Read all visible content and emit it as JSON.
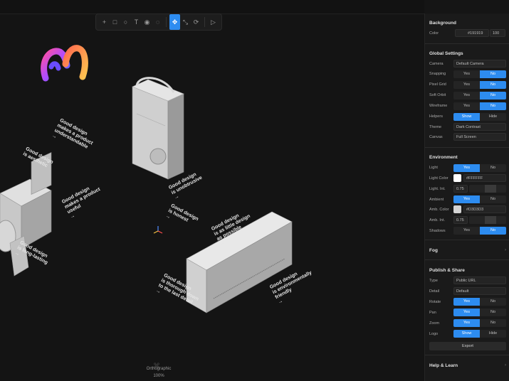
{
  "toolbar": {
    "tools": [
      {
        "name": "add-icon",
        "glyph": "+"
      },
      {
        "name": "cube-icon",
        "glyph": "□"
      },
      {
        "name": "sphere-icon",
        "glyph": "○"
      },
      {
        "name": "text-icon",
        "glyph": "T"
      },
      {
        "name": "image-icon",
        "glyph": "◉"
      },
      {
        "name": "material-icon",
        "glyph": "◌"
      },
      {
        "name": "move-icon",
        "glyph": "✥"
      },
      {
        "name": "scale-icon",
        "glyph": "⤡"
      },
      {
        "name": "rotate-icon",
        "glyph": "⟳"
      },
      {
        "name": "play-icon",
        "glyph": "▷"
      }
    ]
  },
  "viewport": {
    "camera_label": "Orthographic",
    "zoom": "100%",
    "annotations": [
      "Good design\nis aesthetic",
      "Good design\nmakes a product\nunderstandable\n→",
      "Good design\nmakes a product\nuseful\n→",
      "Good design\nis unobtrusive\n→",
      "Good design\nis honest\n→",
      "Good design\nis long-lasting\n→",
      "Good design\nis thorough down\nto the last detail\n→",
      "Good design\nis environmentally\nfriendly\n→",
      "Good design\nis as little design\nas possible\n→"
    ]
  },
  "panel": {
    "background": {
      "title": "Background",
      "color_label": "Color",
      "color_value": "#191919",
      "opacity": "100"
    },
    "global": {
      "title": "Global Settings",
      "camera_label": "Camera",
      "camera_value": "Default Camera",
      "snapping_label": "Snapping",
      "pixelgrid_label": "Pixel Grid",
      "softorbit_label": "Soft Orbit",
      "wireframe_label": "Wireframe",
      "helpers_label": "Helpers",
      "theme_label": "Theme",
      "theme_value": "Dark Contrast",
      "canvas_label": "Canvas",
      "canvas_value": "Full Screen",
      "yes": "Yes",
      "no": "No",
      "show": "Show",
      "hide": "Hide"
    },
    "environment": {
      "title": "Environment",
      "light_label": "Light",
      "light_color_label": "Light Color",
      "light_color_value": "#FFFFFF",
      "light_int_label": "Light. Int.",
      "light_int_value": "0.75",
      "ambient_label": "Ambient",
      "amb_color_label": "Amb. Color",
      "amb_color_value": "#D3D3D3",
      "amb_int_label": "Amb. Int.",
      "amb_int_value": "0.75",
      "shadows_label": "Shadows"
    },
    "fog": {
      "title": "Fog"
    },
    "publish": {
      "title": "Publish & Share",
      "type_label": "Type",
      "type_value": "Public URL",
      "detail_label": "Detail",
      "detail_value": "Default",
      "rotate_label": "Rotate",
      "pan_label": "Pan",
      "zoom_label": "Zoom",
      "logo_label": "Logo",
      "export_label": "Export"
    },
    "help": {
      "title": "Help & Learn"
    }
  },
  "colors": {
    "accent": "#2d8cf0",
    "panel": "#1a1a1a",
    "viewport": "#141414",
    "light_swatch": "#ffffff",
    "amb_swatch": "#d3d3d3"
  }
}
